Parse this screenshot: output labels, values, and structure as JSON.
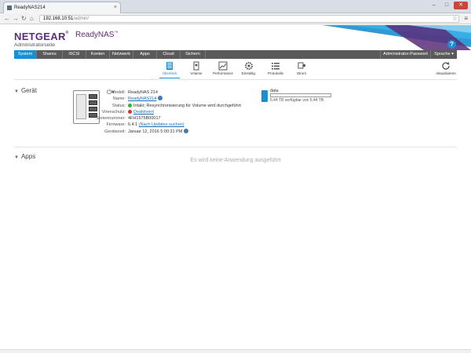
{
  "browser": {
    "tab_title": "ReadyNAS214",
    "url_host": "192.168.10.51",
    "url_path": "/admin/"
  },
  "header": {
    "brand": "NETGEAR",
    "product": "ReadyNAS",
    "subtitle": "Administratorseite",
    "help": "?"
  },
  "mainnav": {
    "items": [
      "System",
      "Shares",
      "iSCSI",
      "Konten",
      "Netzwerk",
      "Apps",
      "Cloud",
      "Sichern"
    ],
    "admin_password": "Administrator-Passwort",
    "language": "Sprache ▾"
  },
  "subnav": {
    "items": [
      "Überblick",
      "Volume",
      "Performance",
      "Einstellg.",
      "Protokolle",
      "Strom"
    ],
    "refresh": "Aktualisieren"
  },
  "device": {
    "section_title": "Gerät",
    "rows": [
      {
        "label": "Modell:",
        "value": "ReadyNAS 214"
      },
      {
        "label": "Name:",
        "value": "ReadyNAS214"
      },
      {
        "label": "Status:",
        "value": "Intakt; Resynchronisierung für Volume wird durchgeführt"
      },
      {
        "label": "Virenschutz:",
        "value": "Deaktiviert"
      },
      {
        "label": "Seriennummer:",
        "value": "4FH1575B00017"
      },
      {
        "label": "Firmware:",
        "value": "6.4.1",
        "extra": "(Nach Updates suchen)"
      },
      {
        "label": "Gerätezeit:",
        "value": "Januar 12, 2016 5:00:31 PM"
      }
    ],
    "status_color": "#2eb82e",
    "antivirus_color": "#d93030"
  },
  "volume": {
    "name": "data",
    "fill_fraction": 0.0,
    "text": "5.44 TB verfügbar von 5.44 TB"
  },
  "apps": {
    "section_title": "Apps",
    "empty_text": "Es wird keine Anwendung ausgeführt"
  },
  "colors": {
    "accent": "#1a8fd0",
    "brand": "#5b2d7a",
    "nav_bg": "#5a5a5a"
  }
}
